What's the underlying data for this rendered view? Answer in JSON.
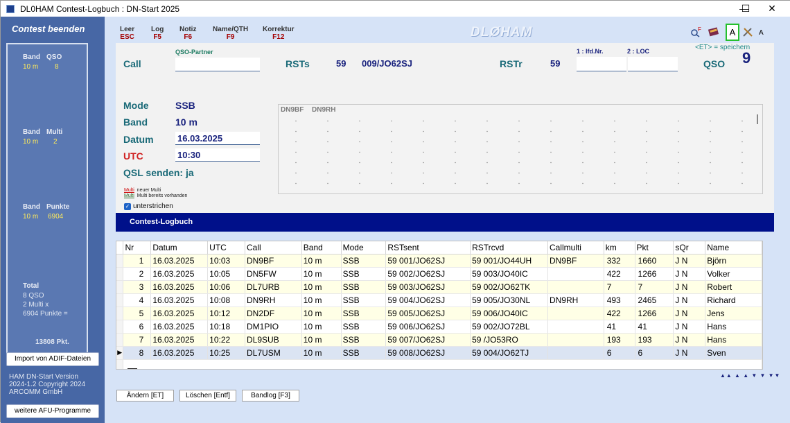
{
  "window": {
    "title": "DL0HAM  Contest-Logbuch : DN-Start 2025",
    "minimize": "—",
    "maximize": "☐",
    "close": "✕"
  },
  "sidebar": {
    "title": "Contest beenden",
    "band_label": "Band",
    "qso_label": "QSO",
    "band_val1": "10 m",
    "qso_val": "8",
    "multi_label": "Multi",
    "band_val2": "10 m",
    "multi_val": "2",
    "punkte_label": "Punkte",
    "band_val3": "10 m",
    "punkte_val": "6904",
    "total_label": "Total",
    "total_qso": "8 QSO",
    "total_multi": "2 Multi x",
    "total_punkte": "6904 Punkte =",
    "total_pkt": "13808 Pkt.",
    "import_button": "Import von ADIF-Dateien",
    "version1": "HAM DN-Start Version",
    "version2": "2024-1.2 Copyright 2024",
    "version3": "ARCOMM GmbH",
    "more_button": "weitere AFU-Programme"
  },
  "toolbar": {
    "leer": "Leer",
    "leer_key": "ESC",
    "log": "Log",
    "log_key": "F5",
    "notiz": "Notiz",
    "notiz_key": "F6",
    "name": "Name/QTH",
    "name_key": "F9",
    "korrektur": "Korrektur",
    "korrektur_key": "F12",
    "brand": "DLØHAM",
    "font_a_large": "A",
    "font_a_small": "A"
  },
  "entry": {
    "qso_partner": "QSO-Partner",
    "call_label": "Call",
    "call_value": "",
    "rsts_label": "RSTs",
    "rsts_value": "59",
    "sent_exchange": "009/JO62SJ",
    "rstr_label": "RSTr",
    "rstr_value": "59",
    "lfd_label": "1 : lfd.Nr.",
    "loc_label": "2 : LOC",
    "et_save": "<ET> = speichern",
    "qso_label": "QSO",
    "qso_count": "9",
    "mode_label": "Mode",
    "mode_value": "SSB",
    "band_label": "Band",
    "band_value": "10 m",
    "datum_label": "Datum",
    "datum_value": "16.03.2025",
    "utc_label": "UTC",
    "utc_value": "10:30",
    "qsl_label": "QSL senden: ja",
    "grid_lbl1": "DN9BF",
    "grid_lbl2": "DN9RH",
    "legend1_tag": "Multi",
    "legend1_text": "neuer Multi",
    "legend2_tag": "Multi",
    "legend2_text": "Multi bereits vorhanden",
    "underline_label": "unterstrichen"
  },
  "logbook": {
    "title": "Contest-Logbuch",
    "columns": [
      "Nr",
      "Datum",
      "UTC",
      "Call",
      "Band",
      "Mode",
      "RSTsent",
      "RSTrcvd",
      "Callmulti",
      "km",
      "Pkt",
      "sQr",
      "Name"
    ],
    "rows": [
      [
        "1",
        "16.03.2025",
        "10:03",
        "DN9BF",
        "10 m",
        "SSB",
        "59  001/JO62SJ",
        "59  001/JO44UH",
        "DN9BF",
        "332",
        "1660",
        "J  N",
        "Björn"
      ],
      [
        "2",
        "16.03.2025",
        "10:05",
        "DN5FW",
        "10 m",
        "SSB",
        "59  002/JO62SJ",
        "59  003/JO40IC",
        "",
        "422",
        "1266",
        "J  N",
        "Volker"
      ],
      [
        "3",
        "16.03.2025",
        "10:06",
        "DL7URB",
        "10 m",
        "SSB",
        "59  003/JO62SJ",
        "59  002/JO62TK",
        "",
        "7",
        "7",
        "J  N",
        "Robert"
      ],
      [
        "4",
        "16.03.2025",
        "10:08",
        "DN9RH",
        "10 m",
        "SSB",
        "59  004/JO62SJ",
        "59  005/JO30NL",
        "DN9RH",
        "493",
        "2465",
        "J  N",
        "Richard"
      ],
      [
        "5",
        "16.03.2025",
        "10:12",
        "DN2DF",
        "10 m",
        "SSB",
        "59  005/JO62SJ",
        "59  006/JO40IC",
        "",
        "422",
        "1266",
        "J  N",
        "Jens"
      ],
      [
        "6",
        "16.03.2025",
        "10:18",
        "DM1PIO",
        "10 m",
        "SSB",
        "59  006/JO62SJ",
        "59  002/JO72BL",
        "",
        "41",
        "41",
        "J  N",
        "Hans"
      ],
      [
        "7",
        "16.03.2025",
        "10:22",
        "DL9SUB",
        "10 m",
        "SSB",
        "59  007/JO62SJ",
        "59  /JO53RO",
        "",
        "193",
        "193",
        "J  N",
        "Hans"
      ],
      [
        "8",
        "16.03.2025",
        "10:25",
        "DL7USM",
        "10 m",
        "SSB",
        "59  008/JO62SJ",
        "59  004/JO62TJ",
        "",
        "6",
        "6",
        "J  N",
        "Sven"
      ]
    ],
    "selected_row": 8
  },
  "buttons": {
    "aendern": "Ändern [ET]",
    "loeschen": "Löschen [Entf]",
    "bandlog": "Bandlog [F3]"
  },
  "nav_arrows": "▲▲ ▲ ▲ ▼ ▼ ▼▼"
}
